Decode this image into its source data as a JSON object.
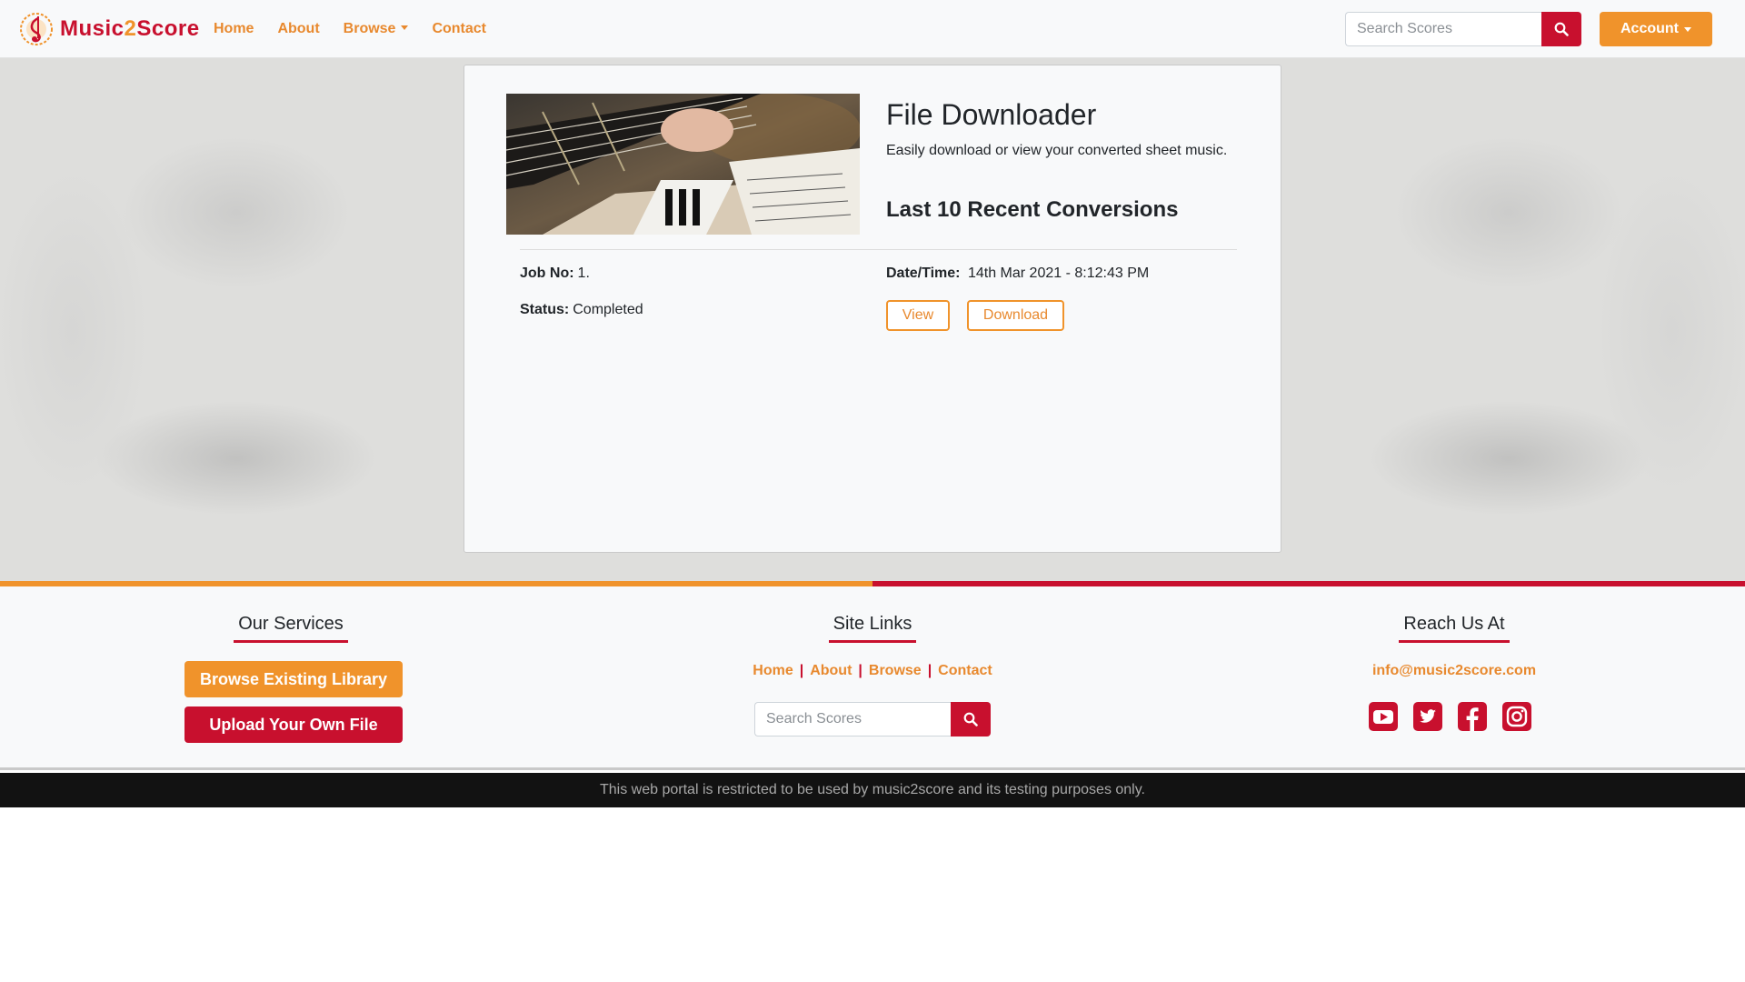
{
  "brand": {
    "name_part1": "Music",
    "name_part2": "2",
    "name_part3": "Score",
    "logo_icon": "music-note-logo-icon"
  },
  "nav": {
    "home": "Home",
    "about": "About",
    "browse": "Browse",
    "contact": "Contact",
    "search_placeholder": "Search Scores",
    "account": "Account"
  },
  "card": {
    "title": "File Downloader",
    "subtitle": "Easily download or view your converted sheet music.",
    "heading": "Last 10 Recent Conversions",
    "job_label": "Job No:",
    "job_value": "1.",
    "status_label": "Status:",
    "status_value": "Completed",
    "datetime_label": "Date/Time:",
    "datetime_value": "14th Mar 2021 - 8:12:43 PM",
    "view_label": "View",
    "download_label": "Download"
  },
  "footer": {
    "services_heading": "Our Services",
    "browse_library": "Browse Existing Library",
    "upload_file": "Upload Your Own File",
    "links_heading": "Site Links",
    "links": [
      "Home",
      "About",
      "Browse",
      "Contact"
    ],
    "search_placeholder": "Search Scores",
    "reach_heading": "Reach Us At",
    "email": "info@music2score.com",
    "socials": [
      "youtube-icon",
      "twitter-icon",
      "facebook-icon",
      "instagram-icon"
    ]
  },
  "bottom_bar": {
    "text": "This web portal is restricted to be used by music2score and its testing purposes only."
  },
  "colors": {
    "orange": "#f0932b",
    "red": "#c8102e",
    "link_orange": "#e8892e"
  }
}
